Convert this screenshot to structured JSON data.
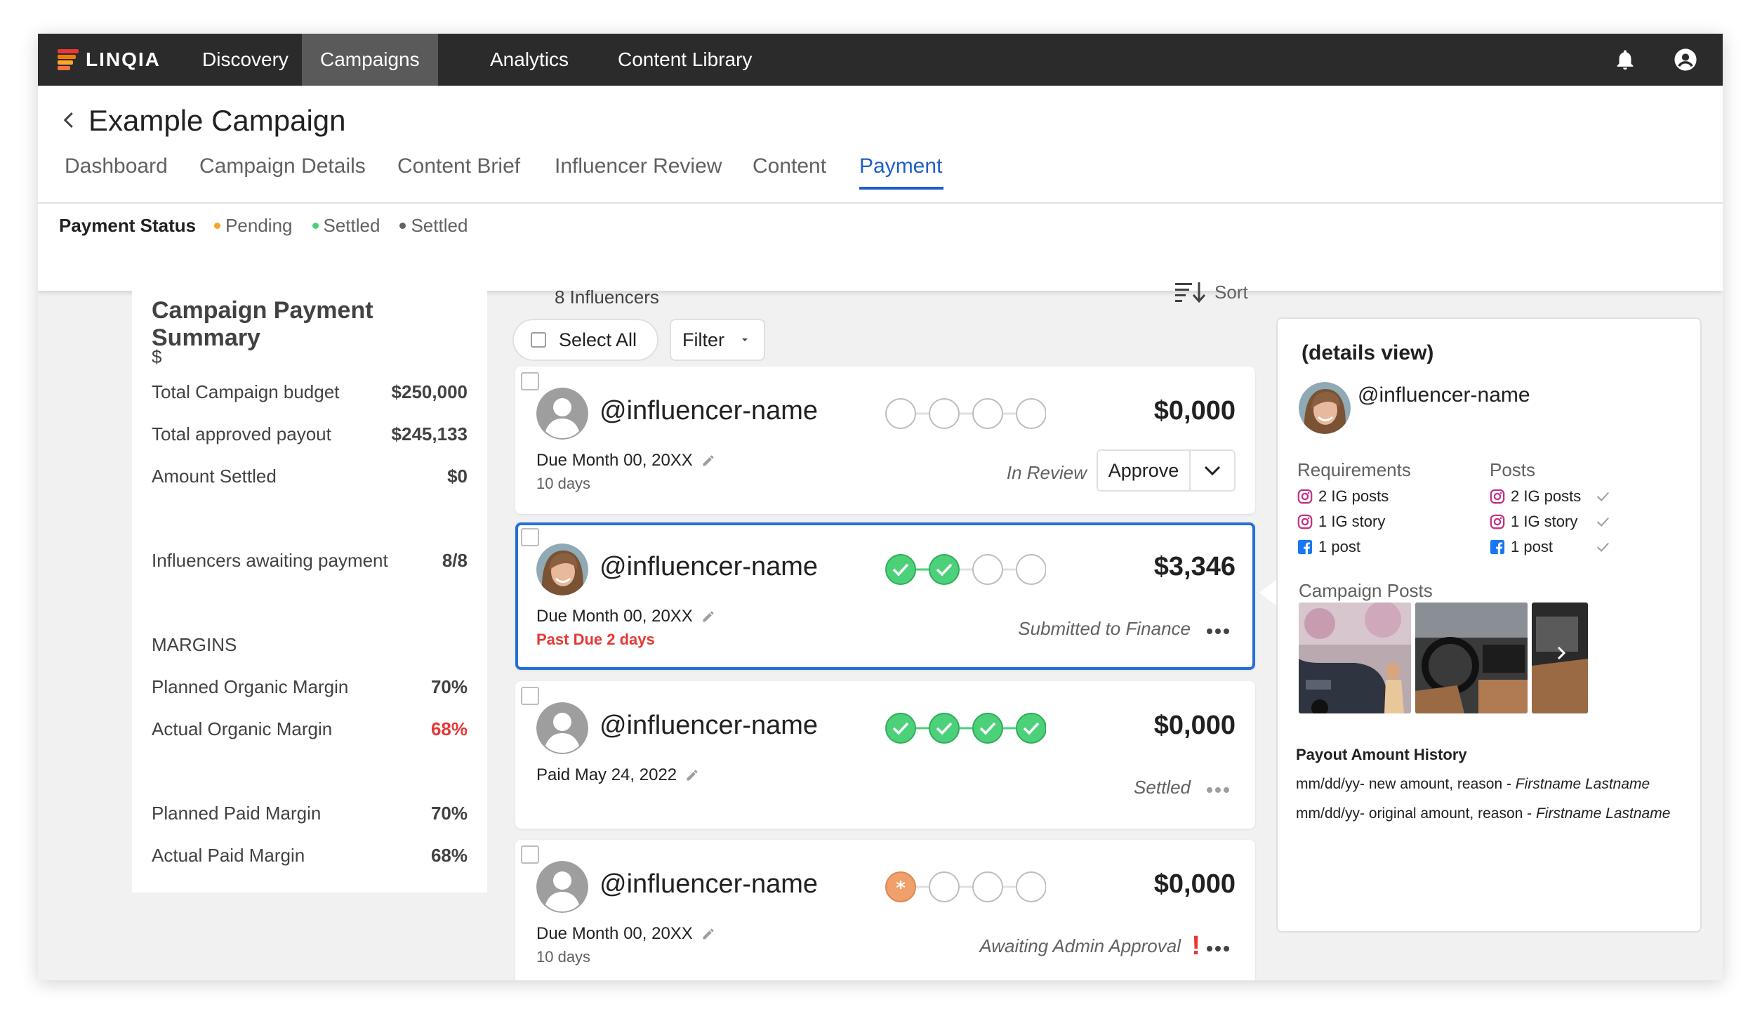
{
  "app": {
    "brand": "LINQIA",
    "nav": [
      "Discovery",
      "Campaigns",
      "Analytics",
      "Content Library"
    ],
    "active_nav": "Campaigns"
  },
  "campaign": {
    "title": "Example Campaign",
    "tabs": [
      "Dashboard",
      "Campaign Details",
      "Content Brief",
      "Influencer Review",
      "Content",
      "Payment"
    ],
    "active_tab": "Payment"
  },
  "payment_status": {
    "label": "Payment Status",
    "items": [
      {
        "label": "Pending",
        "color": "#f5a623"
      },
      {
        "label": "Settled",
        "color": "#4cd17a"
      },
      {
        "label": "Settled",
        "color": "#616161"
      }
    ]
  },
  "summary": {
    "title": "Campaign Payment Summary",
    "currency": "$",
    "rows": [
      {
        "label": "Total Campaign budget",
        "value": "$250,000"
      },
      {
        "label": "Total approved payout",
        "value": "$245,133"
      },
      {
        "label": "Amount Settled",
        "value": "$0"
      },
      {
        "label": "Influencers awaiting payment",
        "value": "8/8"
      }
    ],
    "margins_heading": "MARGINS",
    "margins": [
      {
        "label": "Planned Organic Margin",
        "value": "70%"
      },
      {
        "label": "Actual Organic Margin",
        "value": "68%",
        "color": "#e53935"
      },
      {
        "label": "Planned Paid Margin",
        "value": "70%"
      },
      {
        "label": "Actual Paid Margin",
        "value": "68%"
      }
    ]
  },
  "list": {
    "count": "8 Influencers",
    "sort_label": "Sort",
    "select_all": "Select All",
    "filter": "Filter"
  },
  "influencers": [
    {
      "name": "@influencer-name",
      "amount": "$0,000",
      "due": "Due Month 00, 20XX",
      "sub": "10 days",
      "status": "In Review",
      "action": "Approve",
      "steps": [
        "empty",
        "empty",
        "empty",
        "empty"
      ],
      "avatar": "placeholder"
    },
    {
      "name": "@influencer-name",
      "amount": "$3,346",
      "due": "Due Month 00, 20XX",
      "sub": "Past Due 2 days",
      "status": "Submitted to Finance",
      "steps": [
        "done",
        "done",
        "empty",
        "empty"
      ],
      "avatar": "photo",
      "selected": true
    },
    {
      "name": "@influencer-name",
      "amount": "$0,000",
      "due": "Paid May 24, 2022",
      "sub": "",
      "status": "Settled",
      "steps": [
        "done",
        "done",
        "done",
        "done"
      ],
      "avatar": "placeholder"
    },
    {
      "name": "@influencer-name",
      "amount": "$0,000",
      "due": "Due Month 00, 20XX",
      "sub": "10 days",
      "status": "Awaiting Admin Approval",
      "alert": "!",
      "steps": [
        "pending",
        "empty",
        "empty",
        "empty"
      ],
      "avatar": "placeholder"
    }
  ],
  "details": {
    "title": "(details view)",
    "name": "@influencer-name",
    "requirements_heading": "Requirements",
    "posts_heading": "Posts",
    "requirements": [
      {
        "icon": "instagram-icon",
        "label": "2 IG posts"
      },
      {
        "icon": "instagram-icon",
        "label": "1 IG story"
      },
      {
        "icon": "facebook-icon",
        "label": "1 post"
      }
    ],
    "posts": [
      {
        "icon": "instagram-icon",
        "label": "2 IG posts"
      },
      {
        "icon": "instagram-icon",
        "label": "1 IG story"
      },
      {
        "icon": "facebook-icon",
        "label": "1 post"
      }
    ],
    "campaign_posts_heading": "Campaign Posts",
    "payout_heading": "Payout Amount History",
    "payout_history": [
      {
        "text": "mm/dd/yy- new amount, reason - ",
        "by": "Firstname Lastname"
      },
      {
        "text": "mm/dd/yy- original amount, reason - ",
        "by": "Firstname Lastname"
      }
    ]
  },
  "colors": {
    "accent": "#1f5fc6",
    "success": "#4cd17a",
    "pending": "#f0a06a",
    "error": "#e53935",
    "instagram": "#c13584",
    "facebook": "#1877f2"
  }
}
